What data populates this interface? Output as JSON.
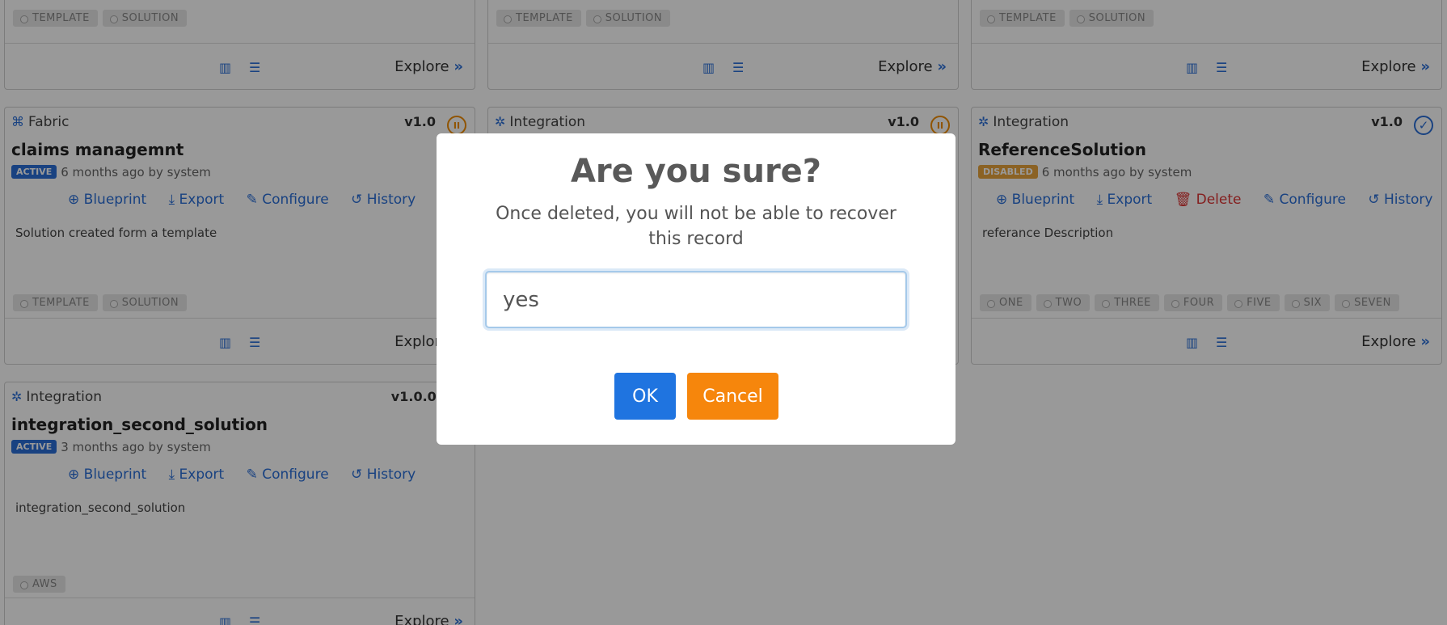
{
  "cards": {
    "c1": {
      "tags": [
        "TEMPLATE",
        "SOLUTION"
      ],
      "explore": "Explore"
    },
    "c2": {
      "tags": [
        "TEMPLATE",
        "SOLUTION"
      ],
      "explore": "Explore"
    },
    "c3": {
      "tags": [
        "TEMPLATE",
        "SOLUTION"
      ],
      "explore": "Explore"
    },
    "c4": {
      "type": "Fabric",
      "version": "v1.0",
      "title": "claims managemnt",
      "status": "ACTIVE",
      "meta": "6 months ago by system",
      "actions": [
        "Blueprint",
        "Export",
        "Configure",
        "History"
      ],
      "desc": "Solution created form a template",
      "tags": [
        "TEMPLATE",
        "SOLUTION"
      ],
      "explore": "Explore"
    },
    "c5": {
      "type": "Integration",
      "version": "v1.0"
    },
    "c6": {
      "type": "Integration",
      "version": "v1.0",
      "title": "ReferenceSolution",
      "status": "DISABLED",
      "meta": "6 months ago by system",
      "actions": [
        "Blueprint",
        "Export",
        "Delete",
        "Configure",
        "History"
      ],
      "desc": "referance Description",
      "tags": [
        "ONE",
        "TWO",
        "THREE",
        "FOUR",
        "FIVE",
        "SIX",
        "SEVEN"
      ],
      "explore": "Explore"
    },
    "c7": {
      "type": "Integration",
      "version": "v1.0.0.2",
      "title": "integration_second_solution",
      "status": "ACTIVE",
      "meta": "3 months ago by system",
      "actions": [
        "Blueprint",
        "Export",
        "Configure",
        "History"
      ],
      "desc": "integration_second_solution",
      "tags": [
        "AWS"
      ],
      "explore": "Explore"
    }
  },
  "dialog": {
    "title": "Are you sure?",
    "message": "Once deleted, you will not be able to recover this record",
    "input_value": "yes",
    "ok_label": "OK",
    "cancel_label": "Cancel"
  }
}
